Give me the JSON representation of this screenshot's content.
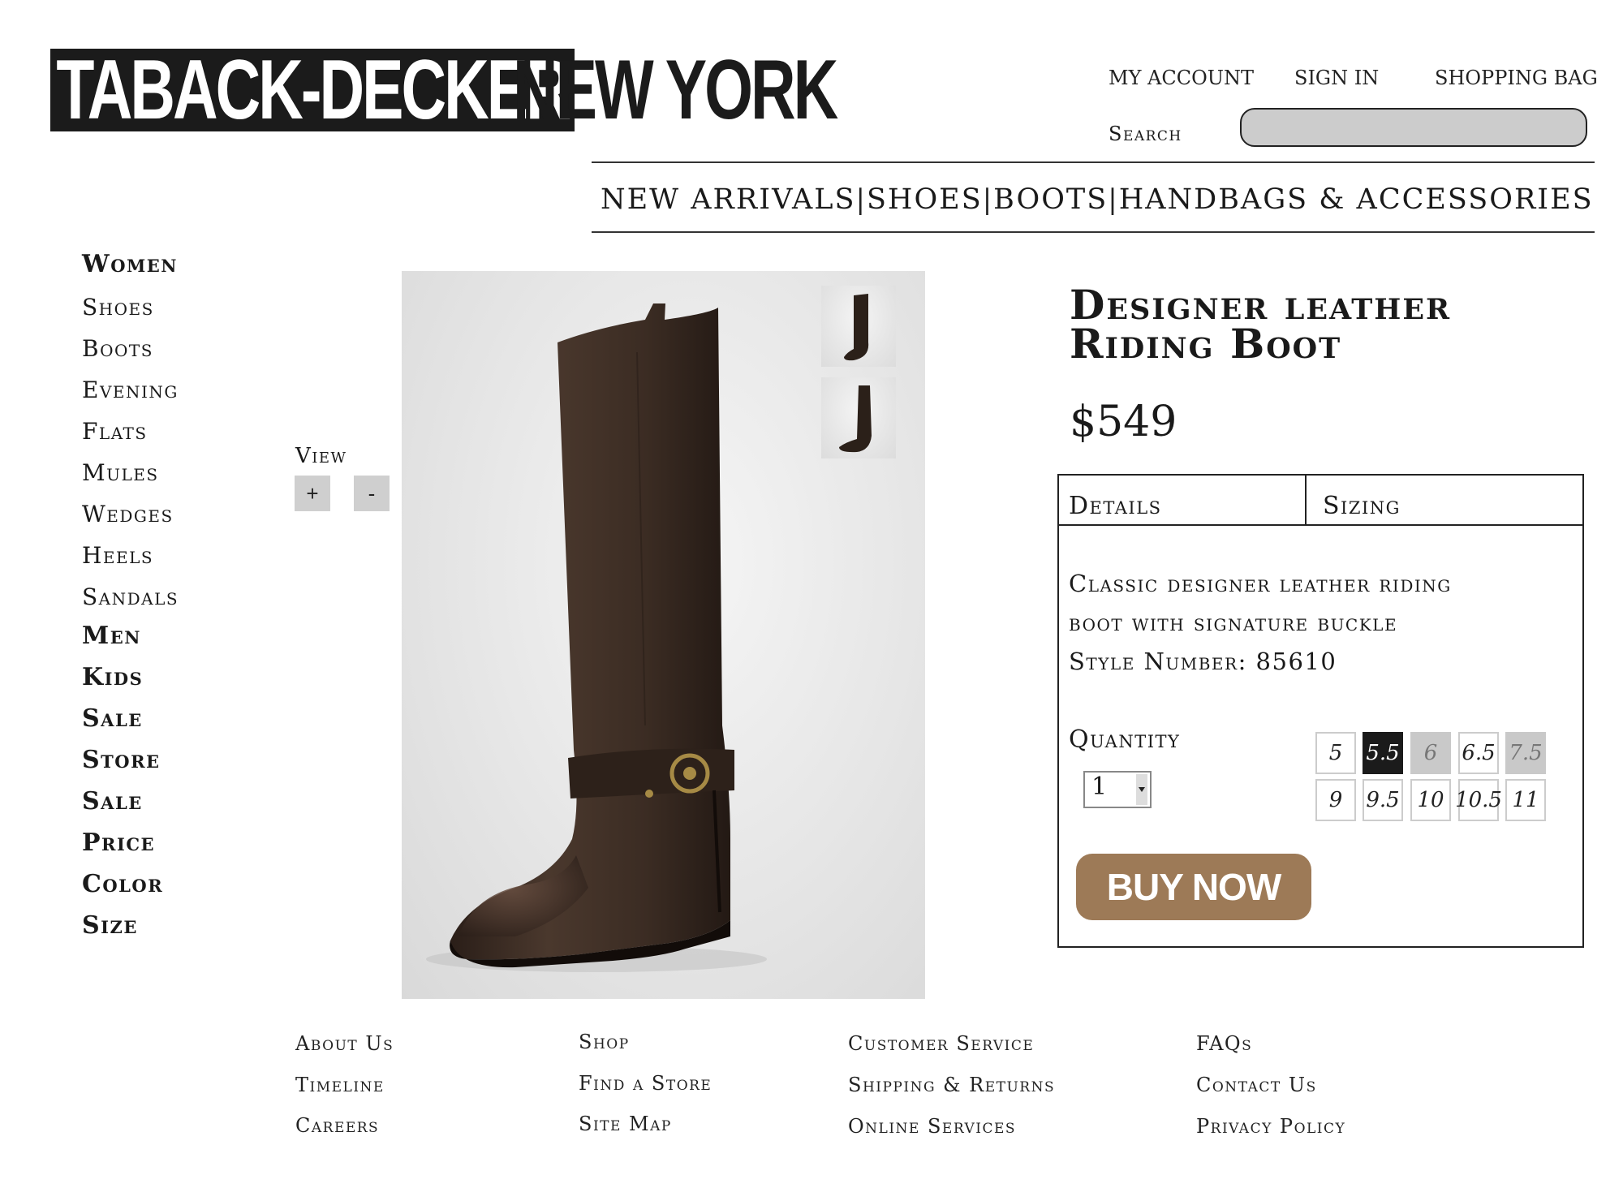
{
  "logo": {
    "dark_text": "TABACK-DECKER",
    "light_text": "NEW YORK"
  },
  "account": {
    "my_account": "MY ACCOUNT",
    "sign_in": "SIGN IN",
    "shopping_bag": "SHOPPING BAG"
  },
  "search": {
    "label": "Search",
    "value": ""
  },
  "topnav": {
    "items": [
      "NEW ARRIVALS",
      "SHOES",
      "BOOTS",
      "HANDBAGS & ACCESSORIES"
    ],
    "separator": "|"
  },
  "sidebar": {
    "items": [
      "Women",
      "Shoes",
      "Boots",
      "Evening",
      "Flats",
      "Mules",
      "Wedges",
      "Heels",
      "Sandals",
      "Men",
      "Kids",
      "Sale",
      "Store",
      "Sale",
      "Price",
      "Color",
      "Size"
    ]
  },
  "view": {
    "label": "View",
    "zoom_in": "+",
    "zoom_out": "-"
  },
  "product": {
    "title_line1": "Designer leather",
    "title_line2": "Riding Boot",
    "price": "$549",
    "tabs": {
      "details": "Details",
      "sizing": "Sizing"
    },
    "description_line1": "Classic designer leather riding",
    "description_line2": "boot with signature buckle",
    "style_number": "Style Number: 85610",
    "quantity_label": "Quantity",
    "quantity_value": "1",
    "sizes_row1": [
      "5",
      "5.5",
      "6",
      "6.5",
      "7.5"
    ],
    "sizes_row2": [
      "9",
      "9.5",
      "10",
      "10.5",
      "11"
    ],
    "selected_size": "5.5",
    "unavailable_sizes": [
      "6",
      "7.5"
    ],
    "buy_label": "BUY NOW",
    "buy_color": "#9d7a57"
  },
  "footer": {
    "col1": [
      "About Us",
      "Timeline",
      "Careers"
    ],
    "col2": [
      "Shop",
      "Find a Store",
      "Site Map"
    ],
    "col3": [
      "Customer Service",
      "Shipping & Returns",
      "Online Services"
    ],
    "col4": [
      "FAQs",
      "Contact Us",
      "Privacy Policy"
    ]
  }
}
